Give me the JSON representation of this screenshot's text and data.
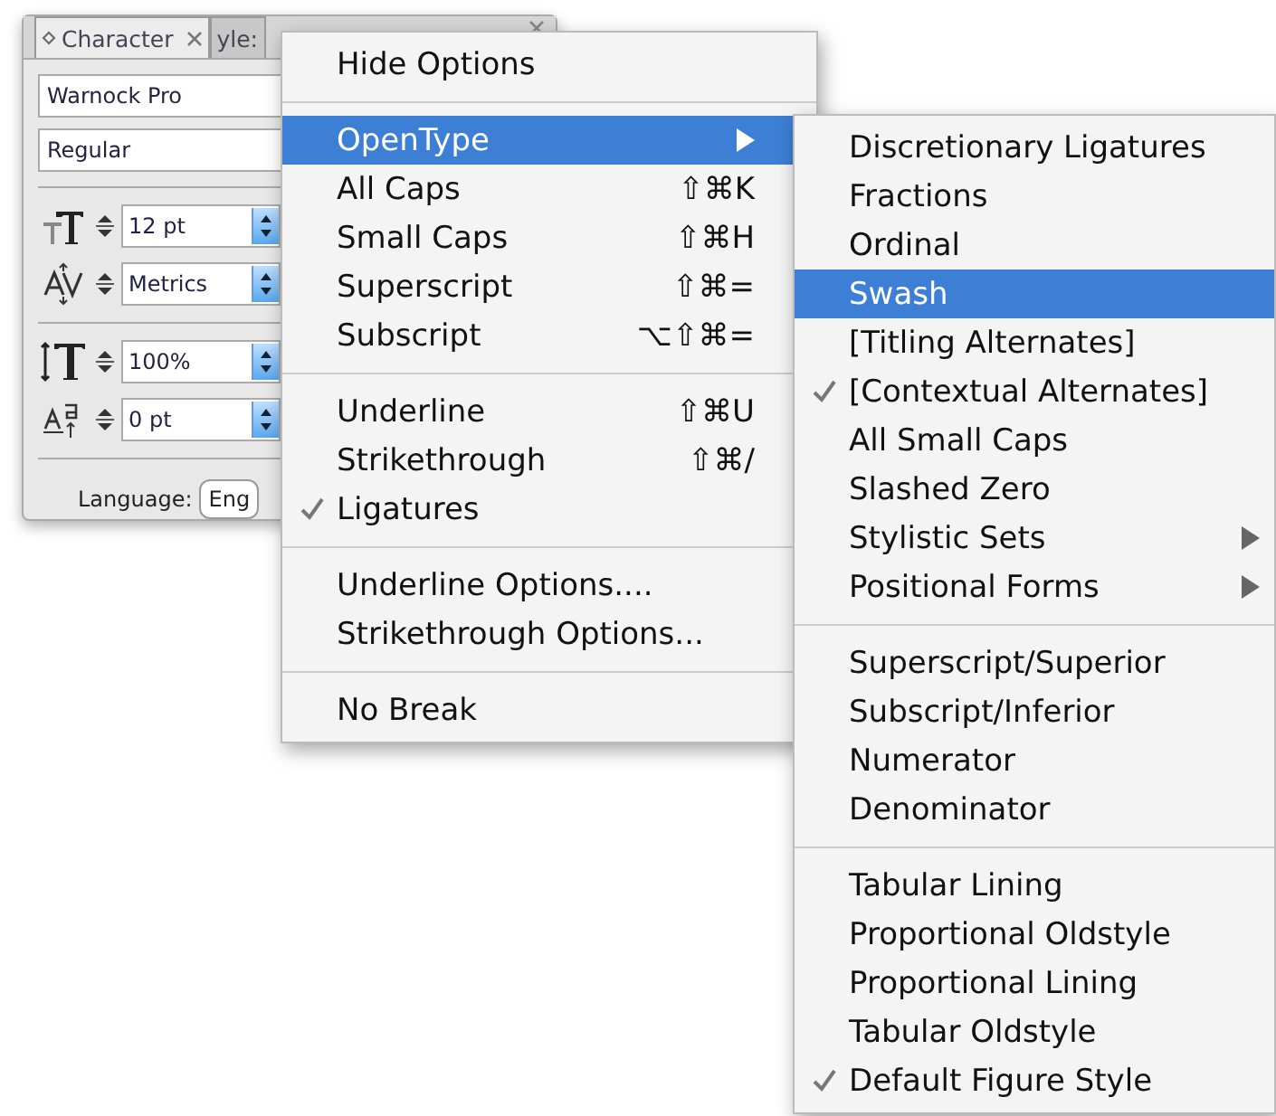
{
  "panel": {
    "tabs": [
      {
        "label": "Character",
        "selected": true
      },
      {
        "label": "yle:",
        "selected": false
      }
    ],
    "font_family": "Warnock Pro",
    "font_style": "Regular",
    "controls": [
      {
        "kind": "size",
        "value": "12 pt"
      },
      {
        "kind": "kerning",
        "value": "Metrics"
      },
      {
        "kind": "scale",
        "value": "100%"
      },
      {
        "kind": "baseline",
        "value": "0 pt"
      }
    ],
    "language_label": "Language:",
    "language_value": "Eng"
  },
  "menu": {
    "items": [
      {
        "kind": "item",
        "label": "Hide Options",
        "checked": false,
        "selected": false,
        "submenu": false
      },
      {
        "kind": "separator"
      },
      {
        "kind": "item",
        "label": "OpenType",
        "checked": false,
        "selected": true,
        "submenu": true
      },
      {
        "kind": "item",
        "label": "All Caps",
        "shortcut": "⇧⌘K",
        "checked": false,
        "selected": false,
        "submenu": false
      },
      {
        "kind": "item",
        "label": "Small Caps",
        "shortcut": "⇧⌘H",
        "checked": false,
        "selected": false,
        "submenu": false
      },
      {
        "kind": "item",
        "label": "Superscript",
        "shortcut": "⇧⌘=",
        "checked": false,
        "selected": false,
        "submenu": false
      },
      {
        "kind": "item",
        "label": "Subscript",
        "shortcut": "⌥⇧⌘=",
        "checked": false,
        "selected": false,
        "submenu": false
      },
      {
        "kind": "separator"
      },
      {
        "kind": "item",
        "label": "Underline",
        "shortcut": "⇧⌘U",
        "checked": false,
        "selected": false,
        "submenu": false
      },
      {
        "kind": "item",
        "label": "Strikethrough",
        "shortcut": "⇧⌘/",
        "checked": false,
        "selected": false,
        "submenu": false
      },
      {
        "kind": "item",
        "label": "Ligatures",
        "checked": true,
        "selected": false,
        "submenu": false
      },
      {
        "kind": "separator"
      },
      {
        "kind": "item",
        "label": "Underline Options....",
        "checked": false,
        "selected": false,
        "submenu": false
      },
      {
        "kind": "item",
        "label": "Strikethrough Options...",
        "checked": false,
        "selected": false,
        "submenu": false
      },
      {
        "kind": "separator"
      },
      {
        "kind": "item",
        "label": "No Break",
        "checked": false,
        "selected": false,
        "submenu": false
      }
    ]
  },
  "submenu": {
    "items": [
      {
        "kind": "item",
        "label": "Discretionary Ligatures",
        "checked": false,
        "selected": false,
        "submenu": false
      },
      {
        "kind": "item",
        "label": "Fractions",
        "checked": false,
        "selected": false,
        "submenu": false
      },
      {
        "kind": "item",
        "label": "Ordinal",
        "checked": false,
        "selected": false,
        "submenu": false
      },
      {
        "kind": "item",
        "label": "Swash",
        "checked": false,
        "selected": true,
        "submenu": false
      },
      {
        "kind": "item",
        "label": "[Titling Alternates]",
        "checked": false,
        "selected": false,
        "submenu": false
      },
      {
        "kind": "item",
        "label": "[Contextual Alternates]",
        "checked": true,
        "selected": false,
        "submenu": false
      },
      {
        "kind": "item",
        "label": "All Small Caps",
        "checked": false,
        "selected": false,
        "submenu": false
      },
      {
        "kind": "item",
        "label": "Slashed Zero",
        "checked": false,
        "selected": false,
        "submenu": false
      },
      {
        "kind": "item",
        "label": "Stylistic Sets",
        "checked": false,
        "selected": false,
        "submenu": true
      },
      {
        "kind": "item",
        "label": "Positional Forms",
        "checked": false,
        "selected": false,
        "submenu": true
      },
      {
        "kind": "separator"
      },
      {
        "kind": "item",
        "label": "Superscript/Superior",
        "checked": false,
        "selected": false,
        "submenu": false
      },
      {
        "kind": "item",
        "label": "Subscript/Inferior",
        "checked": false,
        "selected": false,
        "submenu": false
      },
      {
        "kind": "item",
        "label": "Numerator",
        "checked": false,
        "selected": false,
        "submenu": false
      },
      {
        "kind": "item",
        "label": "Denominator",
        "checked": false,
        "selected": false,
        "submenu": false
      },
      {
        "kind": "separator"
      },
      {
        "kind": "item",
        "label": "Tabular Lining",
        "checked": false,
        "selected": false,
        "submenu": false
      },
      {
        "kind": "item",
        "label": "Proportional Oldstyle",
        "checked": false,
        "selected": false,
        "submenu": false
      },
      {
        "kind": "item",
        "label": "Proportional Lining",
        "checked": false,
        "selected": false,
        "submenu": false
      },
      {
        "kind": "item",
        "label": "Tabular Oldstyle",
        "checked": false,
        "selected": false,
        "submenu": false
      },
      {
        "kind": "item",
        "label": "Default Figure Style",
        "checked": true,
        "selected": false,
        "submenu": false
      }
    ]
  }
}
